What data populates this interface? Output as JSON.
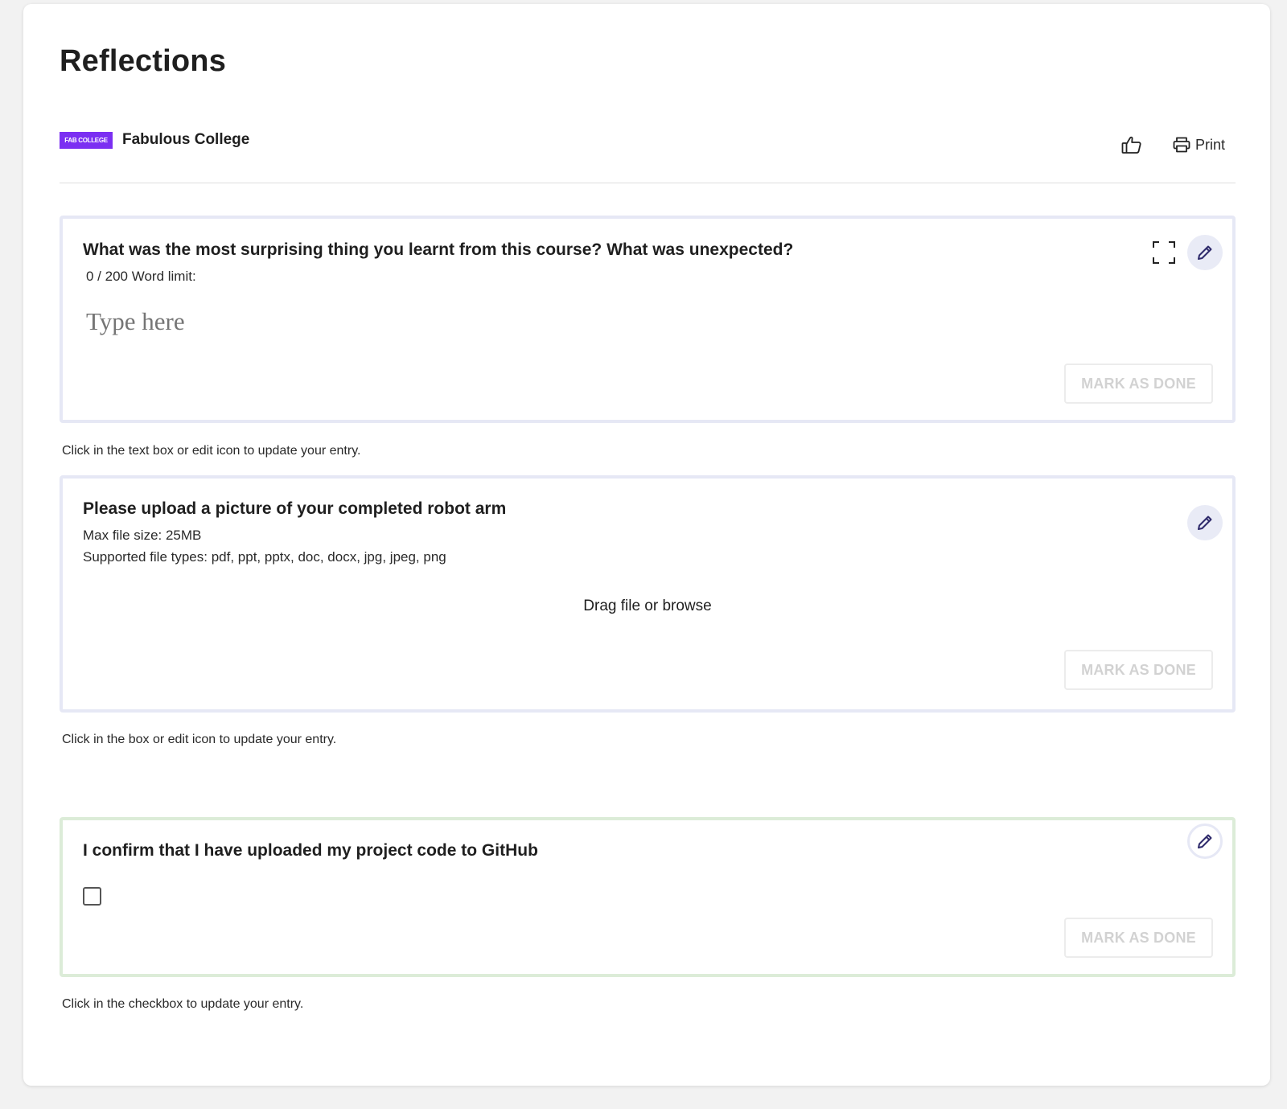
{
  "page": {
    "title": "Reflections"
  },
  "provider": {
    "logo_text": "FAB COLLEGE",
    "name": "Fabulous College",
    "logo_color": "#7b2ff2"
  },
  "header_actions": {
    "like_icon": "thumbs-up-icon",
    "print_label": "Print"
  },
  "reflections": [
    {
      "type": "text",
      "title": "What was the most surprising thing you learnt from this course? What was unexpected?",
      "word_count": "0 / 200 Word limit:",
      "placeholder": "Type here",
      "mark_done_label": "MARK AS DONE",
      "hint": "Click in the text box or edit icon to update your entry."
    },
    {
      "type": "upload",
      "title": "Please upload a picture of your completed robot arm",
      "max_file_size": "Max file size: 25MB",
      "supported_types": "Supported file types: pdf, ppt, pptx, doc, docx, jpg, jpeg, png",
      "drop_label": "Drag file or browse",
      "mark_done_label": "MARK AS DONE",
      "hint": "Click in the box or edit icon to update your entry."
    },
    {
      "type": "checkbox",
      "title": "I confirm that I have uploaded my project code to GitHub",
      "checked": false,
      "mark_done_label": "MARK AS DONE",
      "hint": "Click in the checkbox to update your entry."
    }
  ],
  "colors": {
    "accent_border": "#e6e8f5",
    "complete_border": "#dcecd8",
    "edit_icon": "#2e2a6b"
  }
}
